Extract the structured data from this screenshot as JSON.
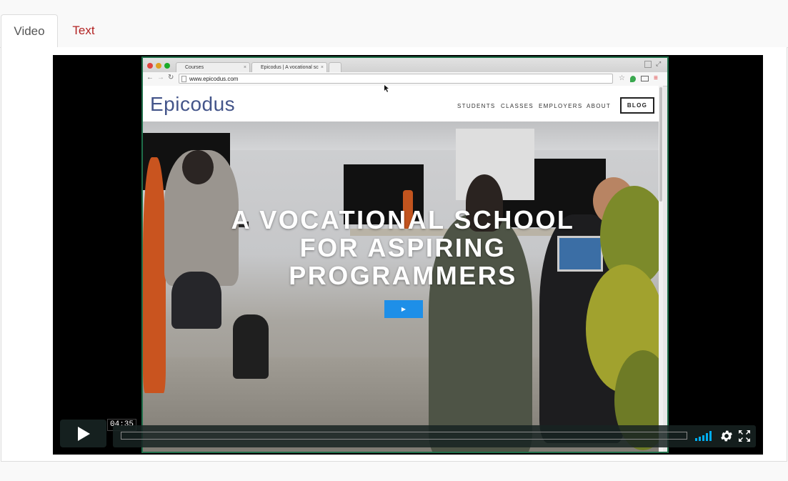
{
  "tabs": [
    {
      "label": "Video",
      "active": true
    },
    {
      "label": "Text",
      "active": false
    }
  ],
  "browser": {
    "tabs": [
      {
        "label": "Courses"
      },
      {
        "label": "Epicodus | A vocational sc"
      }
    ],
    "url": "www.epicodus.com"
  },
  "site": {
    "logo": "Epicodus",
    "nav": [
      "STUDENTS",
      "CLASSES",
      "EMPLOYERS",
      "ABOUT"
    ],
    "blog_button": "BLOG",
    "hero_lines": [
      "A VOCATIONAL SCHOOL",
      "FOR ASPIRING",
      "PROGRAMMERS"
    ]
  },
  "player": {
    "timecode": "04:35",
    "progress": 0.0
  },
  "colors": {
    "tab_inactive_text": "#b22222",
    "accent": "#00adef",
    "hero_button": "#1e8fe8"
  }
}
